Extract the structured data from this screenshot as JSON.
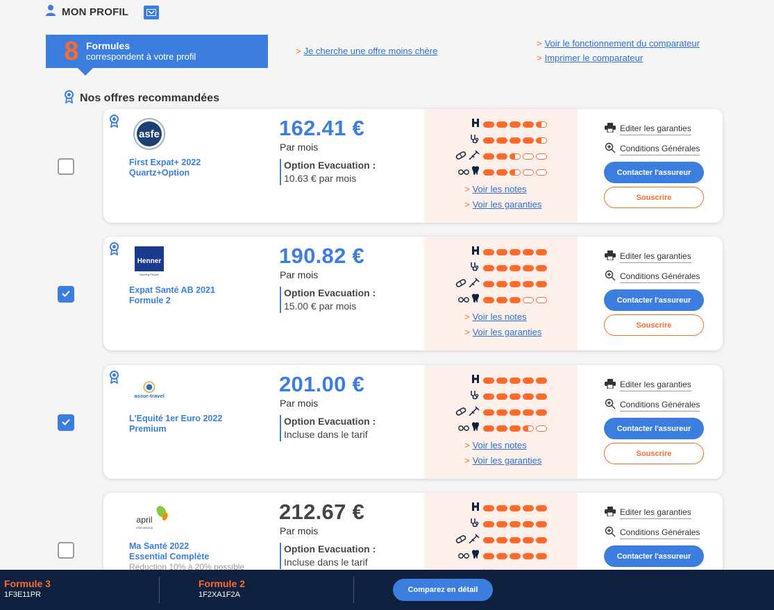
{
  "header": {
    "profile_title": "MON PROFIL",
    "formules_count": "8",
    "formules_title": "Formules",
    "formules_sub": "correspondent à votre profil",
    "link_cheaper": "Je cherche une offre moins chère",
    "link_how": "Voir le fonctionnement du comparateur",
    "link_print": "Imprimer le comparateur",
    "chevron": ">"
  },
  "reco": {
    "title": "Nos offres recommandées"
  },
  "labels": {
    "per_month": "Par mois",
    "evac_label": "Option Evacuation :",
    "voir_notes": "Voir les notes",
    "voir_garanties": "Voir les garanties",
    "editer": "Editer les garanties",
    "conditions": "Conditions Générales",
    "contacter": "Contacter l'assureur",
    "souscrire": "Souscrire"
  },
  "offers": [
    {
      "insurer": "asfe",
      "name_line1": "First Expat+ 2022",
      "name_line2": "Quartz+Option",
      "price": "162.41 €",
      "evac_value": "10.63 € par mois",
      "checked": false,
      "ratings": {
        "hospital": 4.5,
        "doctor": 4.5,
        "pharmacy": 2.5,
        "optical_dental": 2.5
      }
    },
    {
      "insurer": "Henner",
      "insurer_tagline": "Insuring People",
      "name_line1": "Expat Santé AB 2021",
      "name_line2": "Formule 2",
      "price": "190.82 €",
      "evac_value": "15.00 € par mois",
      "checked": true,
      "ratings": {
        "hospital": 5,
        "doctor": 5,
        "pharmacy": 5,
        "optical_dental": 3
      }
    },
    {
      "insurer": "assur-travel",
      "name_line1": "L'Equité 1er Euro 2022",
      "name_line2": "Premium",
      "price": "201.00 €",
      "evac_value": "Incluse dans le tarif",
      "checked": true,
      "ratings": {
        "hospital": 5,
        "doctor": 5,
        "pharmacy": 5,
        "optical_dental": 3.5
      }
    },
    {
      "insurer": "april",
      "insurer_tagline": "international",
      "name_line1": "Ma Santé 2022",
      "name_line2": "Essential Complète",
      "extra": "Réduction 10% à 20% possible",
      "price": "212.67 €",
      "evac_value": "Incluse dans le tarif",
      "checked": false,
      "ratings": {
        "hospital": 5,
        "doctor": 5,
        "pharmacy": 5,
        "optical_dental": 5
      }
    }
  ],
  "compare_bar": {
    "slots": [
      {
        "title": "Formule 3",
        "code": "1F3E11PR"
      },
      {
        "title": "Formule 2",
        "code": "1F2XA1F2A"
      }
    ],
    "compare_label": "Comparez en détail"
  },
  "colors": {
    "primary": "#3c7ee0",
    "accent": "#ff6a2a",
    "panel": "#fdf0ea",
    "bar": "#10213f"
  }
}
